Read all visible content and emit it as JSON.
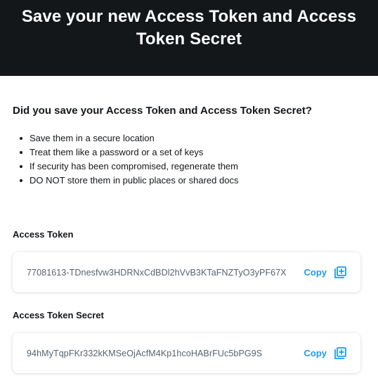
{
  "header": {
    "title": "Save your new Access Token and Access Token Secret"
  },
  "question": "Did you save your Access Token and Access Token Secret?",
  "tips": [
    "Save them in a secure location",
    "Treat them like a password or a set of keys",
    "If security has been compromised, regenerate them",
    "DO NOT store them in public places or shared docs"
  ],
  "access_token": {
    "label": "Access Token",
    "value": "77081613-TDnesfvw3HDRNxCdBDl2hVvB3KTaFNZTyO3yPF67X",
    "copy_label": "Copy"
  },
  "access_token_secret": {
    "label": "Access Token Secret",
    "value": "94hMyTqpFKr332kKMSeOjAcfM4Kp1hcoHABrFUc5bPG9S",
    "copy_label": "Copy"
  },
  "colors": {
    "header_bg": "#14171a",
    "accent": "#1d9bf0",
    "muted_text": "#536471"
  },
  "icons": {
    "copy": "copy-add-icon"
  }
}
